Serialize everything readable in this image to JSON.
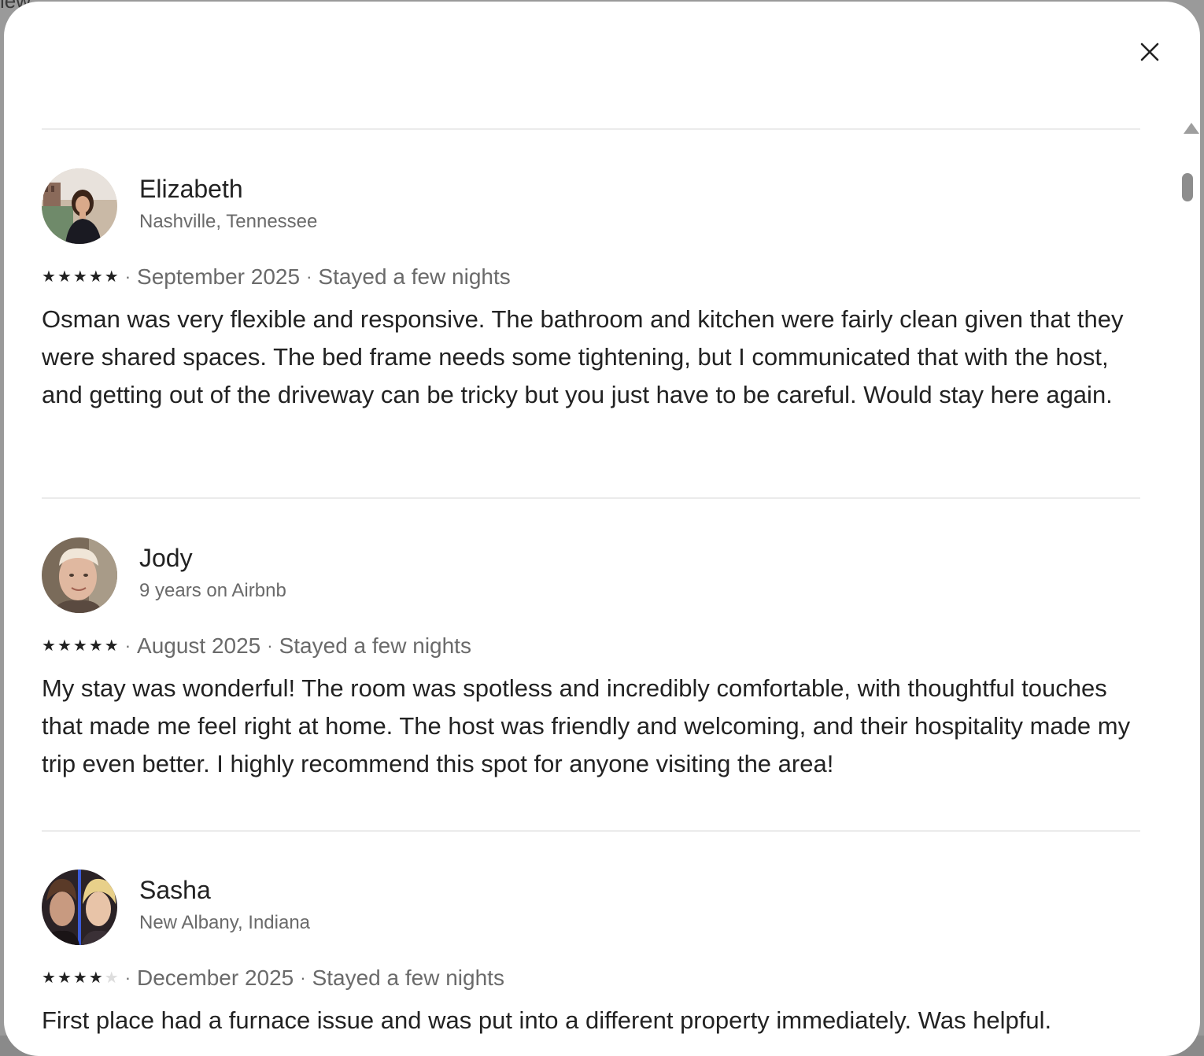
{
  "background": {
    "top_left_fragment": "iew"
  },
  "modal": {
    "close_icon": "close-icon"
  },
  "reviews": [
    {
      "name": "Elizabeth",
      "subtitle": "Nashville, Tennessee",
      "rating": 5,
      "date": "September 2025",
      "stay": "Stayed a few nights",
      "text": "Osman was very flexible and responsive. The bathroom and kitchen were fairly clean given that they were shared spaces. The bed frame needs some tightening, but I communicated that with the host, and getting out of the driveway can be tricky but you just have to be careful. Would stay here again."
    },
    {
      "name": "Jody",
      "subtitle": "9 years on Airbnb",
      "rating": 5,
      "date": "August 2025",
      "stay": "Stayed a few nights",
      "text": "My stay was wonderful! The room was spotless and incredibly comfortable, with thoughtful touches that made me feel right at home. The host was friendly and welcoming, and their hospitality made my trip even better. I highly recommend this spot for anyone visiting the area!"
    },
    {
      "name": "Sasha",
      "subtitle": "New Albany, Indiana",
      "rating": 4,
      "date": "December 2025",
      "stay": "Stayed a few nights",
      "text": "First place had a furnace issue and was put into a different property immediately.  Was helpful."
    }
  ],
  "separator": "·",
  "colors": {
    "text_primary": "#222222",
    "text_secondary": "#6a6a6a",
    "divider": "#ebebeb"
  }
}
